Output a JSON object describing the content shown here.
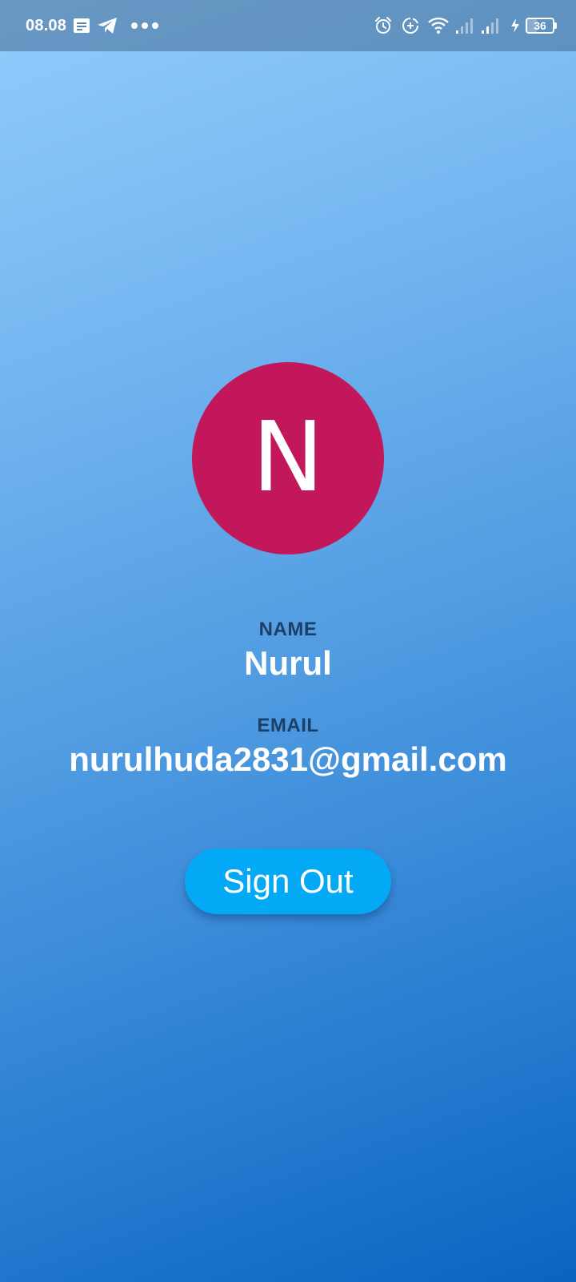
{
  "status_bar": {
    "time": "08.08",
    "battery_level": "36",
    "battery_fraction": 0.36,
    "icons": [
      "notes-icon",
      "telegram-icon",
      "more-dots-icon",
      "alarm-icon",
      "data-saver-icon",
      "wifi-icon",
      "signal-1-icon",
      "signal-2-icon",
      "charging-icon",
      "battery-icon"
    ]
  },
  "profile": {
    "avatar_initial": "N",
    "avatar_color": "#c2185b",
    "name_label": "NAME",
    "name_value": "Nurul",
    "email_label": "EMAIL",
    "email_value": "nurulhuda2831@gmail.com"
  },
  "actions": {
    "sign_out_label": "Sign Out",
    "sign_out_color": "#03a9f4"
  },
  "colors": {
    "gradient_top": "#93ccfc",
    "gradient_bottom": "#0a64bf",
    "label_color": "#1c3f66"
  }
}
